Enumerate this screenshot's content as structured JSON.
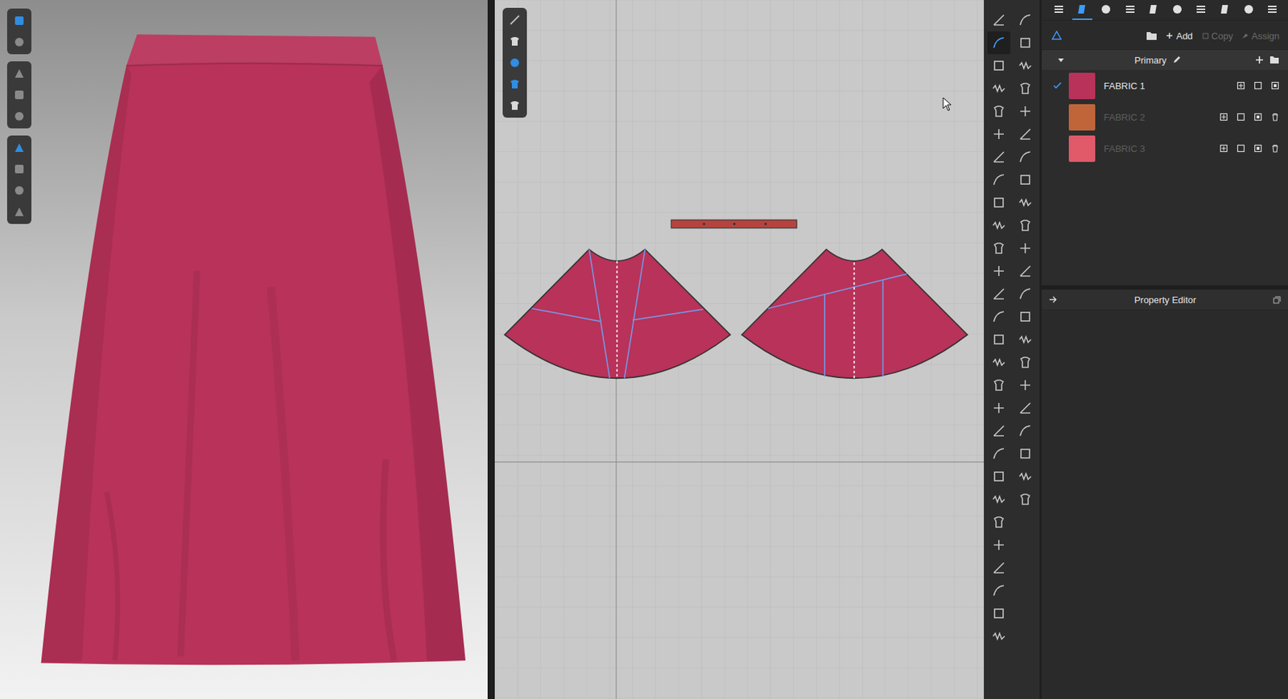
{
  "viewport3d": {
    "toolbar": [
      {
        "selected": true
      },
      {
        "selected": false
      },
      {
        "selected": false
      },
      {
        "selected": false
      },
      {
        "selected": false
      },
      {
        "selected": true
      },
      {
        "selected": false
      },
      {
        "selected": false
      },
      {
        "selected": false
      }
    ]
  },
  "view2d": {
    "toolbar": [
      {
        "selected": false
      },
      {
        "selected": false
      },
      {
        "selected": true
      },
      {
        "selected": true
      },
      {
        "selected": false
      }
    ]
  },
  "toolColumns": {
    "left": [
      {
        "selected": false
      },
      {
        "selected": true
      },
      {
        "selected": false
      },
      {
        "selected": false
      },
      {
        "selected": false
      },
      {
        "selected": false
      },
      {
        "selected": false
      },
      {
        "selected": false
      },
      {
        "selected": false
      },
      {
        "selected": false
      },
      {
        "selected": false
      },
      {
        "selected": false
      },
      {
        "selected": false
      },
      {
        "selected": false
      },
      {
        "selected": false
      },
      {
        "selected": false
      },
      {
        "selected": false
      },
      {
        "selected": false
      },
      {
        "selected": false
      },
      {
        "selected": false
      },
      {
        "selected": false
      },
      {
        "selected": false
      },
      {
        "selected": false
      },
      {
        "selected": false
      },
      {
        "selected": false
      },
      {
        "selected": false
      },
      {
        "selected": false
      },
      {
        "selected": false
      }
    ],
    "right": [
      {
        "selected": false
      },
      {
        "selected": false
      },
      {
        "selected": false
      },
      {
        "selected": false
      },
      {
        "selected": false
      },
      {
        "selected": false
      },
      {
        "selected": false
      },
      {
        "selected": false
      },
      {
        "selected": false
      },
      {
        "selected": false
      },
      {
        "selected": false
      },
      {
        "selected": false
      },
      {
        "selected": false
      },
      {
        "selected": false
      },
      {
        "selected": false
      },
      {
        "selected": false
      },
      {
        "selected": false
      },
      {
        "selected": false
      },
      {
        "selected": false
      },
      {
        "selected": false
      },
      {
        "selected": false
      },
      {
        "selected": false
      }
    ]
  },
  "panelTabs": [
    {
      "selected": false
    },
    {
      "selected": true
    },
    {
      "selected": false
    },
    {
      "selected": false
    },
    {
      "selected": false
    },
    {
      "selected": false
    },
    {
      "selected": false
    },
    {
      "selected": false
    },
    {
      "selected": false
    },
    {
      "selected": false
    }
  ],
  "actions": [
    {
      "label": "Add",
      "disabled": false
    },
    {
      "label": "Copy",
      "disabled": true
    },
    {
      "label": "Assign",
      "disabled": true
    }
  ],
  "colorway": {
    "name": "Primary",
    "expanded": true
  },
  "fabrics": [
    {
      "name": "FABRIC 1",
      "color": "#b8325a",
      "selected": true,
      "disabled": false
    },
    {
      "name": "FABRIC 2",
      "color": "#c0653a",
      "selected": false,
      "disabled": true
    },
    {
      "name": "FABRIC 3",
      "color": "#e05a6a",
      "selected": false,
      "disabled": true
    }
  ],
  "propertyEditor": {
    "title": "Property Editor"
  }
}
